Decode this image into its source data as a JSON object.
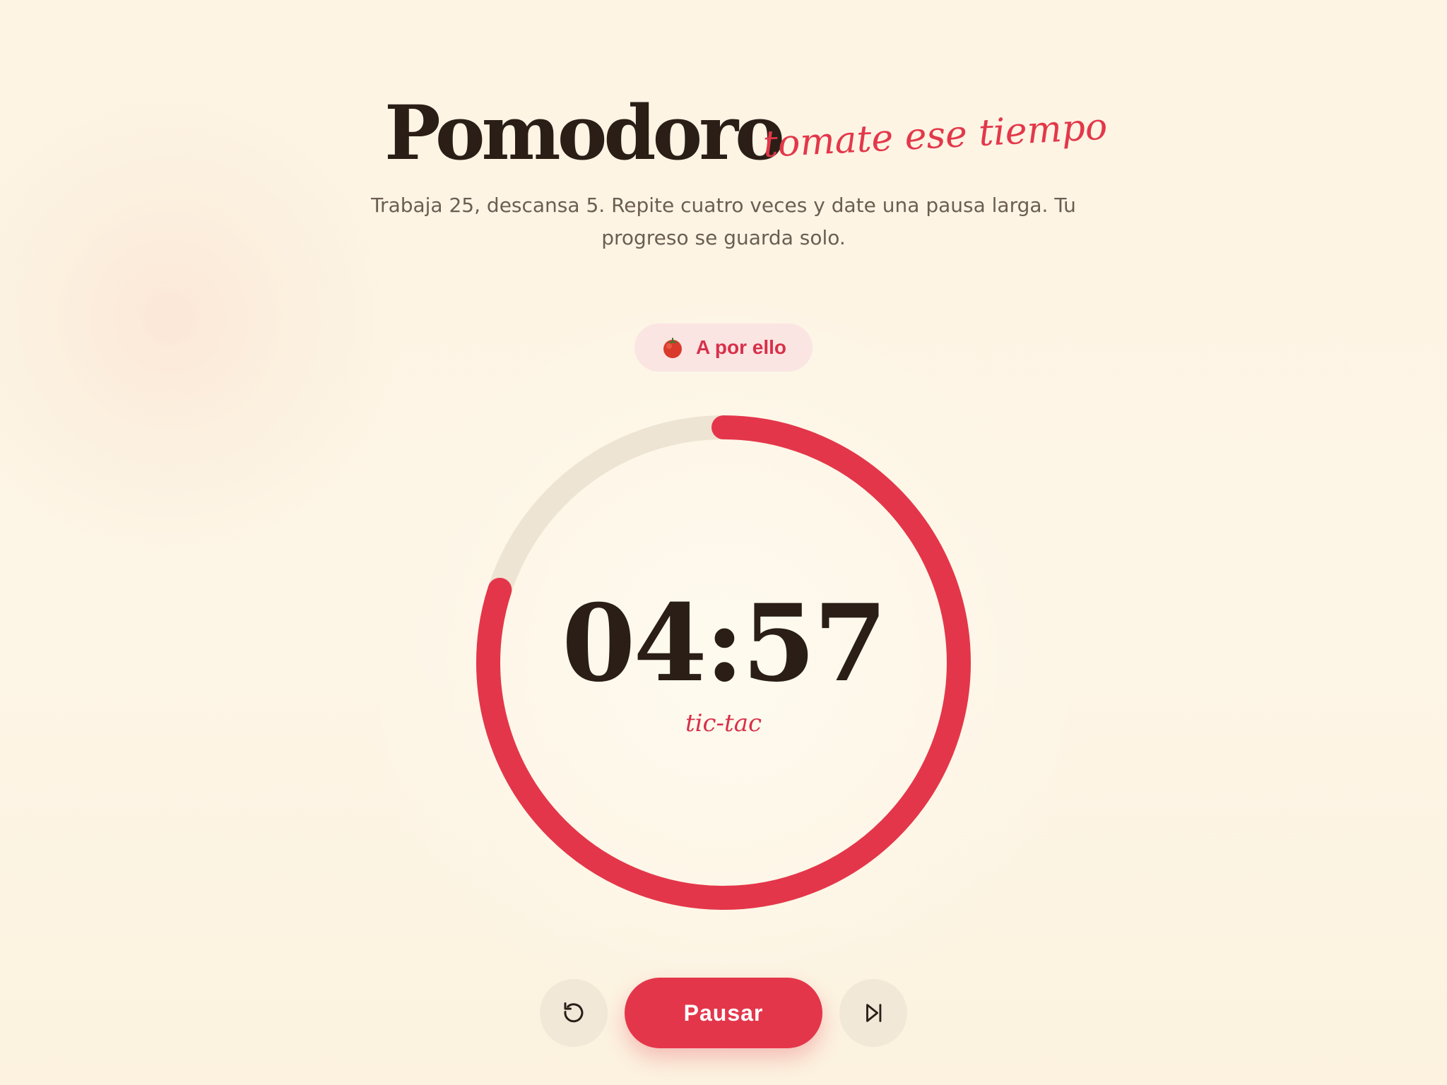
{
  "app": {
    "title": "Pomodoro",
    "tagline": "tomate ese tiempo",
    "subtitle": "Trabaja 25, descansa 5. Repite cuatro veces y date una pausa larga. Tu progreso se guarda solo."
  },
  "status": {
    "icon": "tomato-icon",
    "label": "A por ello"
  },
  "timer": {
    "display": "04:57",
    "caption": "tic-tac",
    "progress_remaining": 0.8,
    "colors": {
      "progress": "#e4364a",
      "track": "#eee4d3"
    }
  },
  "controls": {
    "reset_icon": "reset-icon",
    "pause_label": "Pausar",
    "skip_icon": "skip-forward-icon"
  },
  "colors": {
    "accent": "#e4364a",
    "background": "#fdf5e4",
    "text": "#2a1e16"
  }
}
